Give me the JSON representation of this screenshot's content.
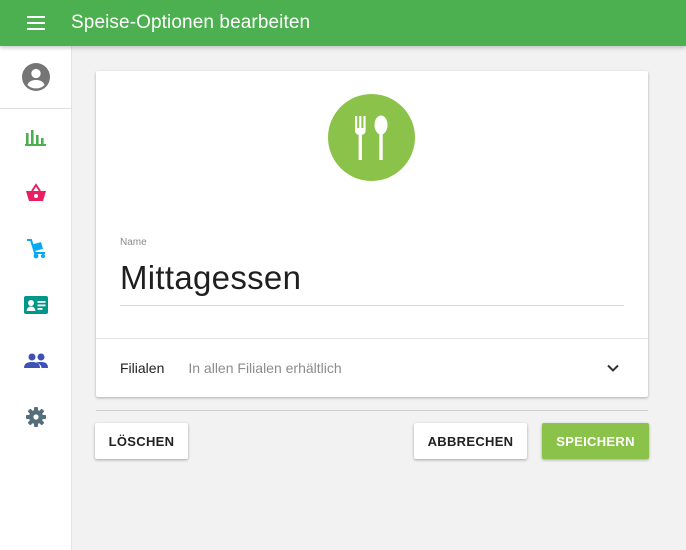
{
  "appbar": {
    "title": "Speise-Optionen bearbeiten",
    "menu_icon": "hamburger-menu-icon",
    "color": "#4caf50"
  },
  "sidebar": {
    "avatar_icon": "account-circle-icon",
    "items": [
      {
        "icon": "bar-chart-icon",
        "color": "#4caf50"
      },
      {
        "icon": "shopping-basket-icon",
        "color": "#e91e63"
      },
      {
        "icon": "hand-truck-icon",
        "color": "#03a9f4"
      },
      {
        "icon": "contact-card-icon",
        "color": "#009688"
      },
      {
        "icon": "people-icon",
        "color": "#3f51b5"
      },
      {
        "icon": "settings-gear-icon",
        "color": "#546e7a"
      }
    ]
  },
  "card": {
    "header_icon": "fork-spoon-icon",
    "header_icon_bg": "#8bc34a",
    "name_label": "Name",
    "name_value": "Mittagessen",
    "branches_label": "Filialen",
    "branches_value": "In allen Filialen erhältlich",
    "branches_icon": "chevron-down-icon"
  },
  "actions": {
    "delete_label": "LÖSCHEN",
    "cancel_label": "ABBRECHEN",
    "save_label": "SPEICHERN",
    "save_color": "#8bc34a"
  }
}
